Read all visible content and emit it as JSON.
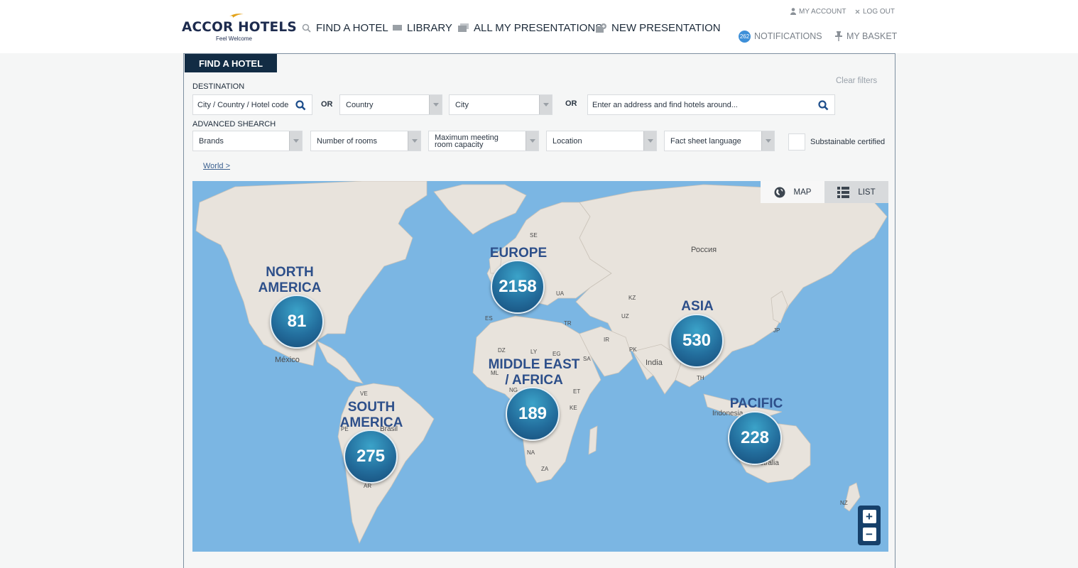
{
  "brand": {
    "name": "ACCOR HOTELS",
    "tagline": "Feel Welcome"
  },
  "nav": {
    "find_hotel": "FIND A HOTEL",
    "library": "LIBRARY",
    "presentations": "ALL MY PRESENTATIONS",
    "new_presentation": "NEW PRESENTATION"
  },
  "account": {
    "my_account": "MY ACCOUNT",
    "logout": "LOG OUT",
    "notifications_count": "262",
    "notifications": "NOTIFICATIONS",
    "basket": "MY BASKET"
  },
  "panel": {
    "tab": "FIND A HOTEL",
    "clear_filters": "Clear filters",
    "destination_label": "DESTINATION",
    "destination_placeholder": "City / Country / Hotel code",
    "or": "OR",
    "country": "Country",
    "city": "City",
    "address_placeholder": "Enter an address and find hotels around...",
    "advanced_label": "ADVANCED SHEARCH",
    "brands": "Brands",
    "rooms": "Number of rooms",
    "meeting": "Maximum meeting room capacity",
    "location": "Location",
    "fact_sheet": "Fact sheet language",
    "sustainable": "Substainable certified",
    "breadcrumb": "World >"
  },
  "map": {
    "view_map": "MAP",
    "view_list": "LIST",
    "zoom_in": "+",
    "zoom_out": "−",
    "regions": [
      {
        "name": "NORTH\nAMERICA",
        "count": "81"
      },
      {
        "name": "EUROPE",
        "count": "2158"
      },
      {
        "name": "ASIA",
        "count": "530"
      },
      {
        "name": "MIDDLE EAST\n/ AFRICA",
        "count": "189"
      },
      {
        "name": "SOUTH\nAMERICA",
        "count": "275"
      },
      {
        "name": "PACIFIC",
        "count": "228"
      }
    ],
    "labels": [
      "Россия",
      "India",
      "México",
      "Brasil",
      "Australia",
      "Indonesia",
      "SE",
      "UA",
      "KZ",
      "UZ",
      "TR",
      "IR",
      "PK",
      "ES",
      "DZ",
      "LY",
      "EG",
      "SA",
      "ML",
      "NG",
      "ET",
      "KE",
      "NA",
      "ZA",
      "TH",
      "JP",
      "VE",
      "PE",
      "AR",
      "NZ"
    ]
  },
  "colors": {
    "ocean": "#7bb6e3",
    "land": "#e8e3dc",
    "accent": "#122c44",
    "cluster": "#236e9d"
  }
}
